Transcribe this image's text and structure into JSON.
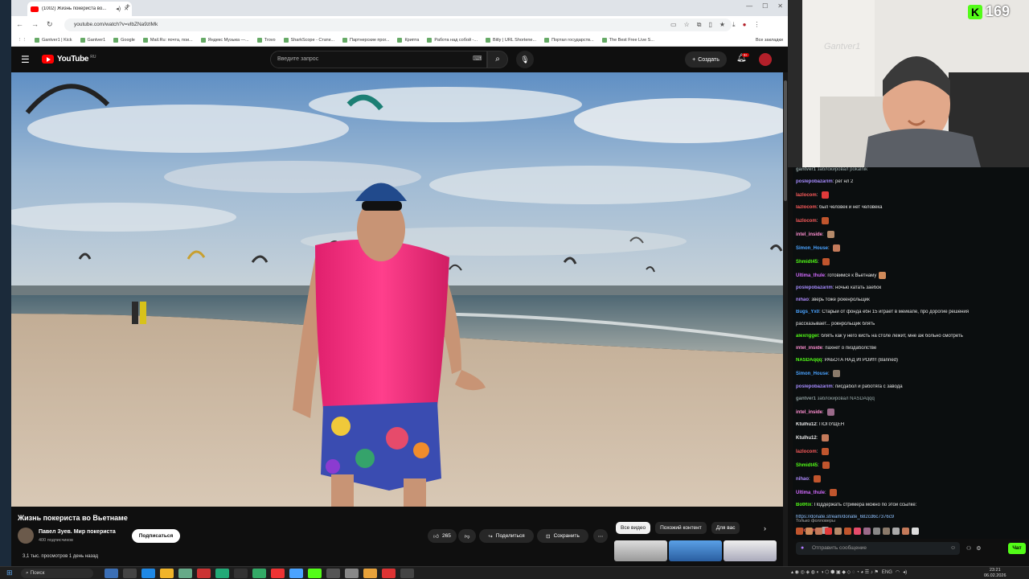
{
  "browser": {
    "tab_title": "(1002) Жизнь покериста во...",
    "url": "youtube.com/watch?v=vlbZNa9zlMk",
    "bookmarks": [
      "Gantver1 | Kick",
      "Gantver1",
      "Google",
      "Mail.Ru: почта, пои...",
      "Яндекс Музыка —...",
      "Trovo",
      "SharkScope - Стати...",
      "Партнерские прог...",
      "Криптa",
      "Работа над собой -...",
      "Bitly | URL Shortene...",
      "Портал государств...",
      "The Best Free Live S..."
    ],
    "bookmarks_all": "Все закладки"
  },
  "youtube": {
    "logo_text": "YouTube",
    "logo_region": "RU",
    "search_placeholder": "Введите запрос",
    "create_label": "Создать",
    "notifications": "9+",
    "video_title": "Жизнь покериста во Вьетнаме",
    "channel_name": "Павел Зуев. Мир покериста",
    "channel_subs": "400 подписчиков",
    "subscribe_label": "Подписаться",
    "likes": "265",
    "share_label": "Поделиться",
    "save_label": "Сохранить",
    "views_line": "3,1 тыс. просмотров  1 день назад",
    "chips": [
      "Все видео",
      "Похожий контент",
      "Для вас"
    ]
  },
  "stream": {
    "viewer_count": "169",
    "webcam_watermark": "Gantver1"
  },
  "chat": {
    "messages": [
      {
        "user": "gantver1",
        "text": "заблокировал pokalnik",
        "color": "#8a9a9a",
        "system": true
      },
      {
        "user": "poslepobazarim",
        "text": "рег нл 2",
        "color": "#a68cff"
      },
      {
        "user": "lazlocom",
        "text": "",
        "color": "#ff5c5c",
        "emote": "#e03a3a"
      },
      {
        "user": "lazlocom",
        "text": "был человек и нет человека",
        "color": "#ff5c5c"
      },
      {
        "user": "lazlocom",
        "text": "",
        "color": "#ff5c5c",
        "emote": "#c0552d"
      },
      {
        "user": "intel_inside",
        "text": "",
        "color": "#ff8fd1",
        "emote": "#b58a6a"
      },
      {
        "user": "Simon_House",
        "text": "",
        "color": "#4aa3ff",
        "emote": "#c47a5a"
      },
      {
        "user": "Shmidt45",
        "text": "",
        "color": "#53fc18",
        "emote": "#c0552d"
      },
      {
        "user": "Ultima_thule",
        "text": "готовимся к Вьетнаму",
        "color": "#d36bff",
        "emote": "#d08a5a"
      },
      {
        "user": "poslepobazarim",
        "text": "ночью катать заебок",
        "color": "#a68cff"
      },
      {
        "user": "nihao",
        "text": "зверь тоже рокенрольщик",
        "color": "#b08cff"
      },
      {
        "user": "Bugs_Yx0",
        "text": "Старый от фонда ебн 15 играет в мейкапе, про дорогие решения",
        "color": "#4aa3ff"
      },
      {
        "user": "",
        "text": "рассказывает... рокнрольщик блять",
        "color": "#e7e7e7"
      },
      {
        "user": "alexriggel",
        "text": "блять как у него кисть на столе лежит, мне аж больно смотреть",
        "color": "#53fc18"
      },
      {
        "user": "intel_inside",
        "text": "пахнет о пиздаболстве",
        "color": "#ff8fd1"
      },
      {
        "user": "NASDAqqq",
        "text": "РАБОТА НАД ИГРОЙ!!! (Banned)",
        "color": "#53fc18"
      },
      {
        "user": "Simon_House",
        "text": "",
        "color": "#4aa3ff",
        "emote": "#8a7a6a"
      },
      {
        "user": "poslepobazarim",
        "text": "писдабол и работяга с завода",
        "color": "#a68cff"
      },
      {
        "user": "gantver1",
        "text": "заблокировал NASDAqqq",
        "color": "#8a9a9a",
        "system": true
      },
      {
        "user": "intel_inside",
        "text": "",
        "color": "#ff8fd1",
        "emote": "#9a6a8a"
      },
      {
        "user": "Ktulhu12",
        "text": "ПОПУЩЕН",
        "color": "#e7e7e7"
      },
      {
        "user": "Ktulhu12",
        "text": "",
        "color": "#e7e7e7",
        "emote": "#c47a5a"
      },
      {
        "user": "lazlocom",
        "text": "",
        "color": "#ff5c5c",
        "emote": "#c0552d"
      },
      {
        "user": "Shmidt45",
        "text": "",
        "color": "#53fc18",
        "emote": "#c0552d"
      },
      {
        "user": "nihao",
        "text": "",
        "color": "#b08cff",
        "emote": "#c0552d"
      },
      {
        "user": "Ultima_thule",
        "text": "",
        "color": "#d36bff",
        "emote": "#c0552d"
      },
      {
        "user": "BotRix",
        "text": "Поддержать стримера можно по этой ссылке:",
        "color": "#53fc18"
      },
      {
        "user": "",
        "text": "https://donate.stream/donate_682cd6c7376c9",
        "color": "#8fc2ff"
      },
      {
        "user": "lazlocom",
        "text": "",
        "color": "#ff5c5c",
        "emote": "#aaaaaa"
      }
    ],
    "followers_only": "Только фолловеры",
    "input_placeholder": "Отправить сообщение",
    "send_label": "Чат"
  },
  "taskbar": {
    "search_label": "Поиск",
    "lang": "ENG",
    "time": "23:21",
    "date": "06.02.2026"
  }
}
